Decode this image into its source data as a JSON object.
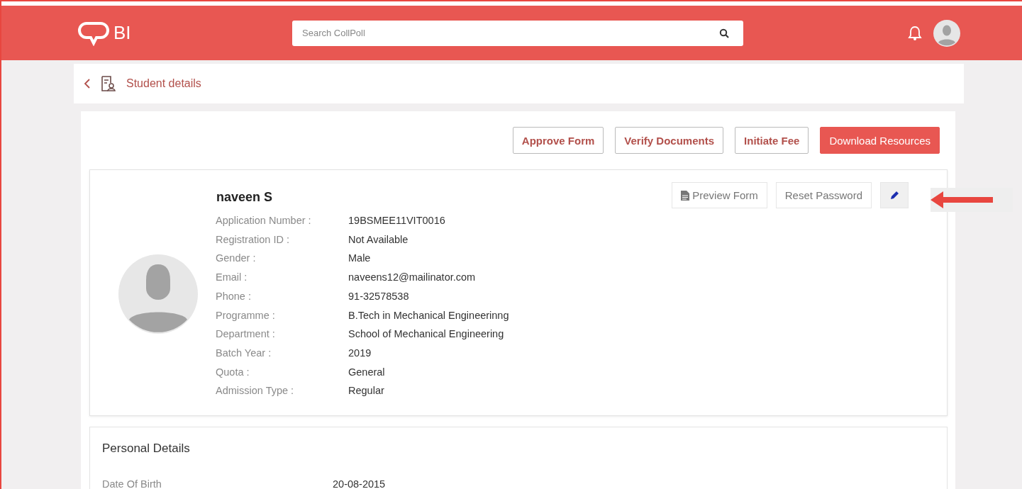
{
  "header": {
    "logo_text": "BI",
    "search": {
      "placeholder": "Search CollPoll"
    }
  },
  "breadcrumb": {
    "title": "Student details"
  },
  "actions": [
    {
      "label": "Approve Form",
      "kind": "outline"
    },
    {
      "label": "Verify Documents",
      "kind": "outline"
    },
    {
      "label": "Initiate Fee",
      "kind": "outline"
    },
    {
      "label": "Download Resources",
      "kind": "primary"
    }
  ],
  "profile": {
    "name": "naveen S",
    "buttons": [
      {
        "label": "Preview Form",
        "kind": "doc"
      },
      {
        "label": "Reset Password",
        "kind": "plain"
      },
      {
        "kind": "edit"
      }
    ],
    "fields": [
      {
        "label": "Application Number :",
        "value": "19BSMEE11VIT0016"
      },
      {
        "label": "Registration ID :",
        "value": "Not Available"
      },
      {
        "label": "Gender :",
        "value": "Male"
      },
      {
        "label": "Email :",
        "value": "naveens12@mailinator.com"
      },
      {
        "label": "Phone :",
        "value": "91-32578538"
      },
      {
        "label": "Programme :",
        "value": "B.Tech in Mechanical Engineerinng"
      },
      {
        "label": "Department :",
        "value": "School of Mechanical Engineering"
      },
      {
        "label": "Batch Year :",
        "value": "2019"
      },
      {
        "label": "Quota :",
        "value": "General"
      },
      {
        "label": "Admission Type :",
        "value": "Regular"
      }
    ]
  },
  "personal_details": {
    "title": "Personal Details",
    "fields": [
      {
        "label": "Date Of Birth",
        "value": "20-08-2015"
      }
    ]
  }
}
